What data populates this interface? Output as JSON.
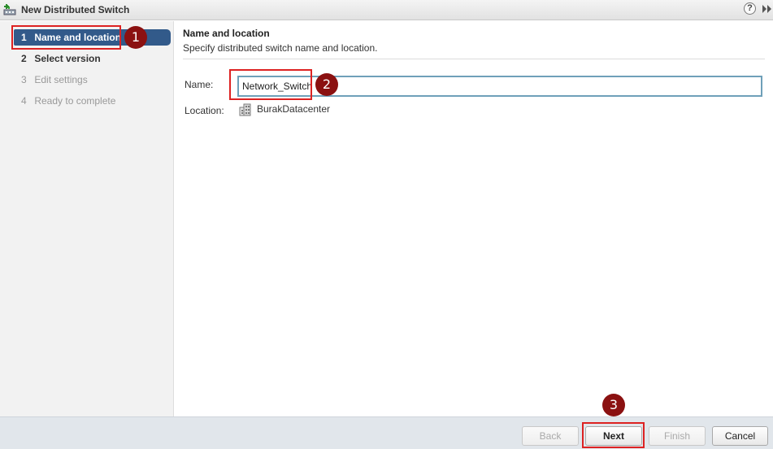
{
  "window": {
    "title": "New Distributed Switch",
    "help_glyph": "?"
  },
  "steps": [
    {
      "num": "1",
      "label": "Name and location",
      "state": "active"
    },
    {
      "num": "2",
      "label": "Select version",
      "state": "normal"
    },
    {
      "num": "3",
      "label": "Edit settings",
      "state": "disabled"
    },
    {
      "num": "4",
      "label": "Ready to complete",
      "state": "disabled"
    }
  ],
  "main": {
    "title": "Name and location",
    "subtitle": "Specify distributed switch name and location.",
    "name_label": "Name:",
    "name_value": "Network_Switch",
    "location_label": "Location:",
    "location_value": "BurakDatacenter"
  },
  "footer": {
    "back": "Back",
    "next": "Next",
    "finish": "Finish",
    "cancel": "Cancel"
  },
  "callouts": {
    "c1": "1",
    "c2": "2",
    "c3": "3"
  },
  "colors": {
    "accent": "#325a8a",
    "highlight": "#dd2222",
    "callout": "#8b1111",
    "input_border": "#6fa0b9"
  }
}
